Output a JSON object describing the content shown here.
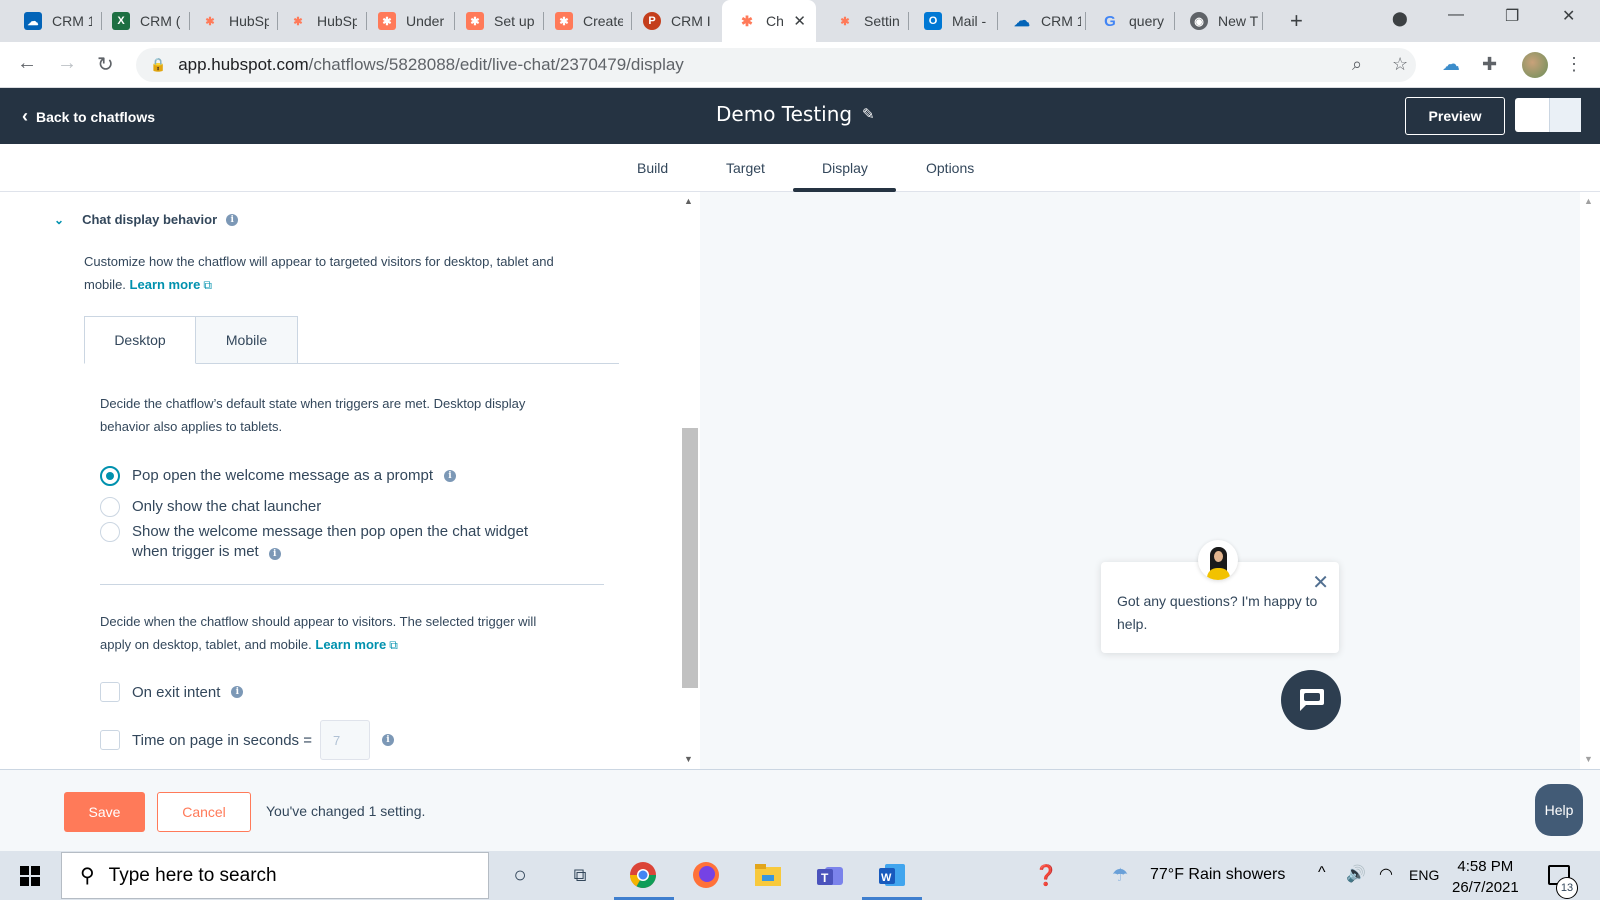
{
  "browser": {
    "tabs": [
      {
        "label": "CRM 1",
        "icon": "onedrive-icon",
        "color": "#0364b8"
      },
      {
        "label": "CRM (",
        "icon": "excel-icon",
        "color": "#1d6f42"
      },
      {
        "label": "HubSp",
        "icon": "hubspot-icon",
        "color": "#ff7a59"
      },
      {
        "label": "HubSp",
        "icon": "hubspot-icon",
        "color": "#ff7a59"
      },
      {
        "label": "Under",
        "icon": "hubspot-icon",
        "color": "#ff7a59"
      },
      {
        "label": "Set up",
        "icon": "hubspot-icon",
        "color": "#ff7a59"
      },
      {
        "label": "Create",
        "icon": "hubspot-icon",
        "color": "#ff7a59"
      },
      {
        "label": "CRM I",
        "icon": "powerpoint-icon",
        "color": "#c43e1c"
      },
      {
        "label": "Ch",
        "icon": "hubspot-icon",
        "color": "#ff7a59",
        "active": true
      },
      {
        "label": "Settin",
        "icon": "hubspot-icon",
        "color": "#ff7a59"
      },
      {
        "label": "Mail -",
        "icon": "outlook-icon",
        "color": "#0078d4"
      },
      {
        "label": "CRM 1",
        "icon": "onedrive-icon",
        "color": "#0364b8"
      },
      {
        "label": "query",
        "icon": "google-icon",
        "color": "#4285f4"
      },
      {
        "label": "New T",
        "icon": "chrome-icon",
        "color": "#5f6368"
      }
    ],
    "url_host": "app.hubspot.com",
    "url_path": "/chatflows/5828088/edit/live-chat/2370479/display"
  },
  "header": {
    "back_label": "Back to chatflows",
    "title": "Demo Testing",
    "preview_label": "Preview"
  },
  "nav_tabs": [
    "Build",
    "Target",
    "Display",
    "Options"
  ],
  "active_nav_tab": "Display",
  "display": {
    "section_title": "Chat display behavior",
    "intro_text": "Customize how the chatflow will appear to targeted visitors for desktop, tablet and",
    "intro_text_2": "mobile.",
    "learn_more": "Learn more",
    "subtabs": [
      "Desktop",
      "Mobile"
    ],
    "default_state_text_1": "Decide the chatflow’s default state when triggers are met. Desktop display",
    "default_state_text_2": "behavior also applies to tablets.",
    "radio_options": [
      {
        "label": "Pop open the welcome message as a prompt",
        "checked": true
      },
      {
        "label": "Only show the chat launcher",
        "checked": false
      },
      {
        "label": "Show the welcome message then pop open the chat widget",
        "label_2": "when trigger is met",
        "checked": false
      }
    ],
    "trigger_text_1": "Decide when the chatflow should appear to visitors. The selected trigger will",
    "trigger_text_2": "apply on desktop, tablet, and mobile.",
    "checkboxes": [
      {
        "label": "On exit intent",
        "checked": false
      },
      {
        "label": "Time on page in seconds =",
        "checked": false,
        "value": "7"
      }
    ]
  },
  "chat_preview": {
    "welcome_message": "Got any questions? I'm happy to help."
  },
  "footer": {
    "save_label": "Save",
    "cancel_label": "Cancel",
    "status_text": "You've changed 1 setting.",
    "help_label": "Help"
  },
  "taskbar": {
    "search_placeholder": "Type here to search",
    "weather": "77°F  Rain showers",
    "language": "ENG",
    "time": "4:58 PM",
    "date": "26/7/2021",
    "notification_count": "13"
  },
  "colors": {
    "hubspot_dark": "#253342",
    "accent_teal": "#0091ae",
    "save_orange": "#ff7a59"
  }
}
